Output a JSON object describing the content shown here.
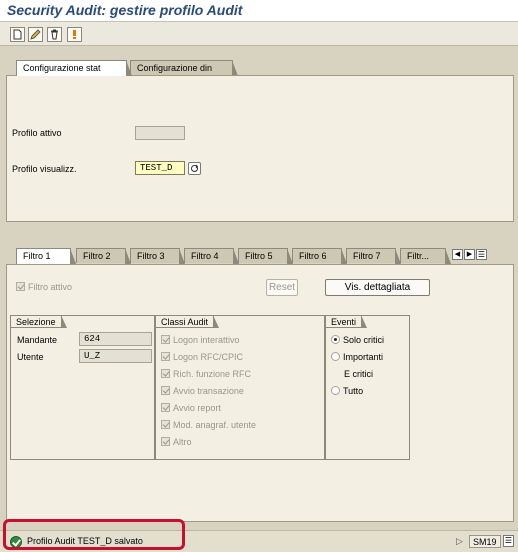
{
  "window": {
    "title": "Security Audit: gestire profilo Audit"
  },
  "toolbar": {
    "buttons": [
      {
        "icon": "new-document-icon"
      },
      {
        "icon": "edit-pencil-icon"
      },
      {
        "icon": "delete-trash-icon"
      },
      {
        "icon": "info-icon"
      }
    ]
  },
  "top_tabs": [
    {
      "label": "Configurazione stat",
      "active": true
    },
    {
      "label": "Configurazione din",
      "active": false
    }
  ],
  "config": {
    "active_profile_label": "Profilo attivo",
    "active_profile_value": "",
    "view_profile_label": "Profilo visualizz.",
    "view_profile_value": "TEST_D"
  },
  "filter_tabs": [
    {
      "label": "Filtro 1",
      "active": true
    },
    {
      "label": "Filtro 2"
    },
    {
      "label": "Filtro 3"
    },
    {
      "label": "Filtro 4"
    },
    {
      "label": "Filtro 5"
    },
    {
      "label": "Filtro 6"
    },
    {
      "label": "Filtro 7"
    },
    {
      "label": "Filtr..."
    }
  ],
  "filter": {
    "active_checkbox_label": "Filtro attivo",
    "reset_label": "Reset",
    "details_label": "Vis. dettagliata"
  },
  "selection": {
    "title": "Selezione",
    "rows": [
      {
        "label": "Mandante",
        "value": "624"
      },
      {
        "label": "Utente",
        "value": "U_Z"
      }
    ]
  },
  "audit_classes": {
    "title": "Classi Audit",
    "items": [
      "Logon interattivo",
      "Logon RFC/CPIC",
      "Rich. funzione RFC",
      "Avvio transazione",
      "Avvio report",
      "Mod. anagraf. utente",
      "Altro"
    ]
  },
  "events": {
    "title": "Eventi",
    "options": [
      {
        "label": "Solo critici",
        "selected": true
      },
      {
        "label": "Importanti",
        "selected": false
      },
      {
        "label": "E critici",
        "selected": false,
        "sub": true
      },
      {
        "label": "Tutto",
        "selected": false
      }
    ]
  },
  "status": {
    "message": "Profilo Audit TEST_D salvato",
    "transaction": "SM19"
  },
  "colors": {
    "title_blue": "#2b4a7f",
    "highlight_red": "#c8102e",
    "success_green": "#2e8b3a"
  }
}
